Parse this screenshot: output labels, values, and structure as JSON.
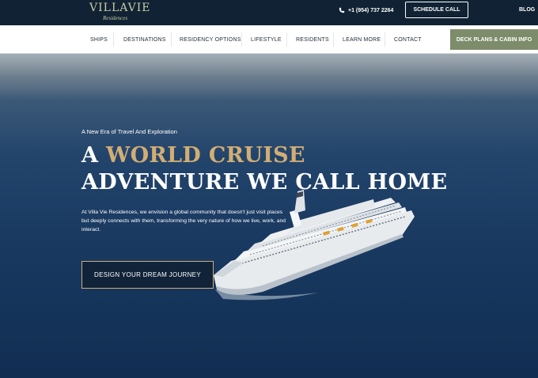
{
  "brand": {
    "logo_main": "VILLAVIE",
    "logo_sub": "Residences",
    "color": "#c9cba4"
  },
  "topbar": {
    "phone": "+1 (954) 737 2264",
    "schedule_label": "SCHEDULE CALL",
    "blog_label": "BLOG",
    "background": "#102233"
  },
  "nav": {
    "items": [
      {
        "label": "SHIPS"
      },
      {
        "label": "DESTINATIONS"
      },
      {
        "label": "RESIDENCY OPTIONS"
      },
      {
        "label": "LIFESTYLE"
      },
      {
        "label": "RESIDENTS"
      },
      {
        "label": "LEARN MORE"
      },
      {
        "label": "CONTACT"
      }
    ],
    "deck_button": "DECK PLANS & CABIN INFO",
    "deck_button_color": "#7d8c6a"
  },
  "hero": {
    "eyebrow": "A New Era of Travel And Exploration",
    "headline_prefix": "A ",
    "headline_highlight": "WORLD CRUISE",
    "headline_line2": "ADVENTURE WE CALL HOME",
    "accent_color": "#d2ad74",
    "body": "At Villa Vie Residences, we envision a global community that doesn't just visit places but deeply connects with them, transforming the very nature of how we live, work, and interact.",
    "cta_label": "DESIGN YOUR DREAM JOURNEY"
  }
}
